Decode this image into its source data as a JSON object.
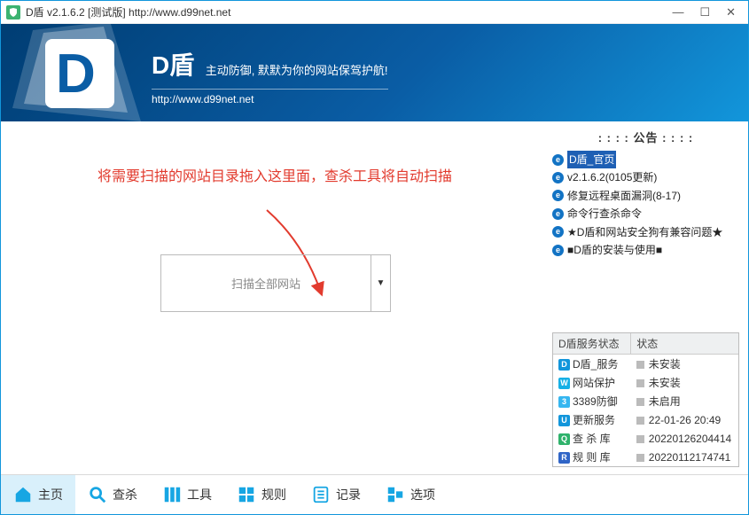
{
  "titlebar": {
    "text": "D盾 v2.1.6.2 [测试版] http://www.d99net.net"
  },
  "header": {
    "name": "D盾",
    "slogan": "主动防御, 默默为你的网站保驾护航!",
    "url": "http://www.d99net.net"
  },
  "main": {
    "hint": "将需要扫描的网站目录拖入这里面，查杀工具将自动扫描",
    "dropzone_label": "扫描全部网站"
  },
  "notice": {
    "heading": ": : : :   公告   : : : :",
    "items": [
      {
        "text": "D盾_官页",
        "highlight": true
      },
      {
        "text": "v2.1.6.2(0105更新)",
        "highlight": false
      },
      {
        "text": "修复远程桌面漏洞(8-17)",
        "highlight": false
      },
      {
        "text": "命令行查杀命令",
        "highlight": false
      },
      {
        "text": "★D盾和网站安全狗有兼容问题★",
        "highlight": false
      },
      {
        "text": "■D盾的安装与使用■",
        "highlight": false
      }
    ]
  },
  "status": {
    "header_service": "D盾服务状态",
    "header_state": "状态",
    "rows": [
      {
        "icon_bg": "#1296db",
        "icon_char": "D",
        "name": "D盾_服务",
        "state": "未安装"
      },
      {
        "icon_bg": "#16b0e6",
        "icon_char": "W",
        "name": "网站保护",
        "state": "未安装"
      },
      {
        "icon_bg": "#35b6f0",
        "icon_char": "3",
        "name": "3389防御",
        "state": "未启用"
      },
      {
        "icon_bg": "#1296db",
        "icon_char": "U",
        "name": "更新服务",
        "state": "22-01-26 20:49"
      },
      {
        "icon_bg": "#2fb26b",
        "icon_char": "Q",
        "name": "查 杀 库",
        "state": "20220126204414"
      },
      {
        "icon_bg": "#3065c7",
        "icon_char": "R",
        "name": "规 则 库",
        "state": "20220112174741"
      }
    ]
  },
  "tabs": {
    "items": [
      {
        "label": "主页",
        "color": "#17a6e3"
      },
      {
        "label": "查杀",
        "color": "#17a6e3"
      },
      {
        "label": "工具",
        "color": "#17a6e3"
      },
      {
        "label": "规则",
        "color": "#17a6e3"
      },
      {
        "label": "记录",
        "color": "#17a6e3"
      },
      {
        "label": "选项",
        "color": "#17a6e3"
      }
    ]
  }
}
